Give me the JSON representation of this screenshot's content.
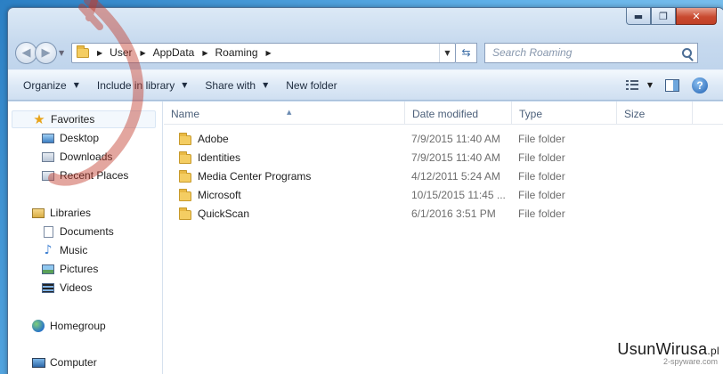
{
  "window": {
    "caption_buttons": {
      "minimize": "▬",
      "maximize": "❐",
      "close": "✕"
    }
  },
  "address": {
    "crumbs": [
      "User",
      "AppData",
      "Roaming"
    ],
    "search_placeholder": "Search Roaming"
  },
  "toolbar": {
    "organize": "Organize",
    "include_in_library": "Include in library",
    "share_with": "Share with",
    "new_folder": "New folder",
    "help": "?"
  },
  "nav": {
    "favorites": "Favorites",
    "desktop": "Desktop",
    "downloads": "Downloads",
    "recent_places": "Recent Places",
    "libraries": "Libraries",
    "documents": "Documents",
    "music": "Music",
    "pictures": "Pictures",
    "videos": "Videos",
    "homegroup": "Homegroup",
    "computer": "Computer"
  },
  "columns": {
    "name": "Name",
    "date_modified": "Date modified",
    "type": "Type",
    "size": "Size"
  },
  "files": [
    {
      "name": "Adobe",
      "date": "7/9/2015 11:40 AM",
      "type": "File folder"
    },
    {
      "name": "Identities",
      "date": "7/9/2015 11:40 AM",
      "type": "File folder"
    },
    {
      "name": "Media Center Programs",
      "date": "4/12/2011 5:24 AM",
      "type": "File folder"
    },
    {
      "name": "Microsoft",
      "date": "10/15/2015 11:45 ...",
      "type": "File folder"
    },
    {
      "name": "QuickScan",
      "date": "6/1/2016 3:51 PM",
      "type": "File folder"
    }
  ],
  "watermark": {
    "main": "UsunWirusa",
    "suffix": ".pl",
    "sub": "2-spyware.com"
  },
  "colors": {
    "overlay_arrow": "#c0392b"
  }
}
